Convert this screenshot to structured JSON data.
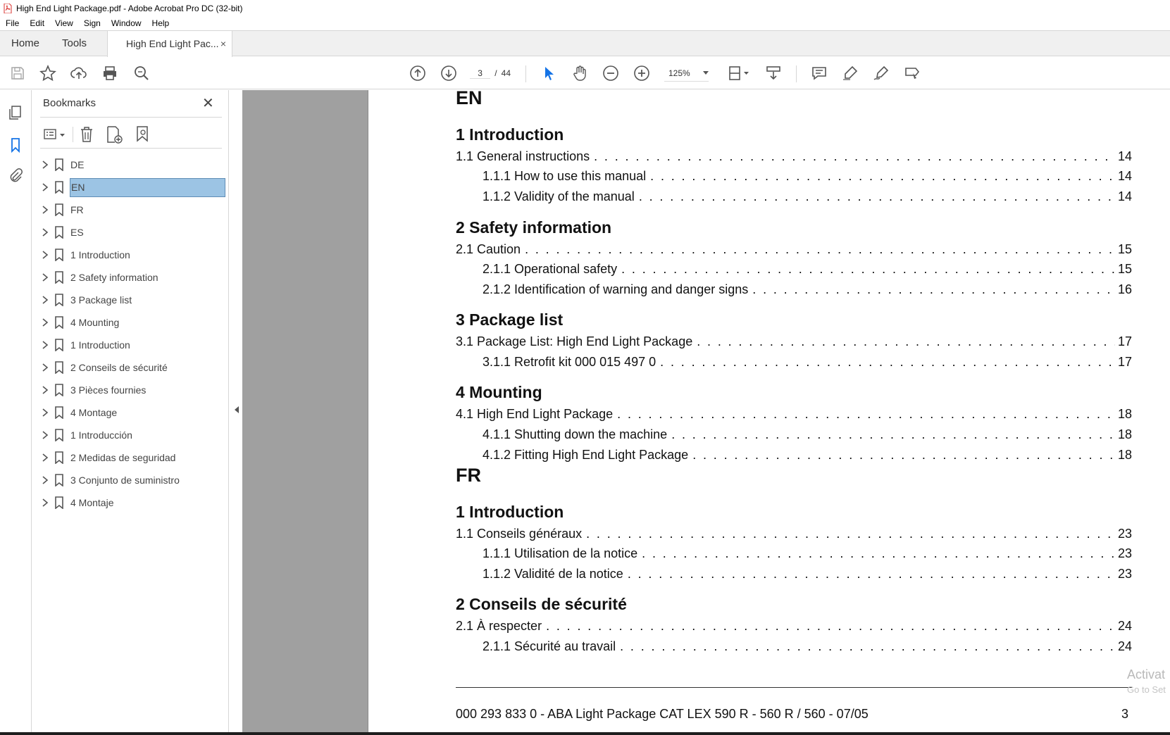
{
  "window": {
    "title": "High End Light Package.pdf - Adobe Acrobat Pro DC (32-bit)"
  },
  "menu": [
    "File",
    "Edit",
    "View",
    "Sign",
    "Window",
    "Help"
  ],
  "tabs": {
    "home": "Home",
    "tools": "Tools",
    "document": "High End Light Pac...",
    "close": "×"
  },
  "toolbar": {
    "page_current": "3",
    "page_sep": "/",
    "page_total": "44",
    "zoom": "125%"
  },
  "bookmarks": {
    "title": "Bookmarks",
    "close": "✕",
    "items": [
      "DE",
      "EN",
      "FR",
      "ES",
      "1 Introduction",
      "2 Safety information",
      "3 Package list",
      "4 Mounting",
      "1 Introduction",
      "2 Conseils de sécurité",
      "3 Pièces fournies",
      "4 Montage",
      "1 Introducción",
      "2 Medidas de seguridad",
      "3 Conjunto de suministro",
      "4 Montaje"
    ],
    "selected": "EN"
  },
  "document": {
    "en": {
      "lang": "EN",
      "ch1": "1 Introduction",
      "e1": {
        "t": "1.1 General instructions",
        "p": "14"
      },
      "e2": {
        "t": "1.1.1 How to use this manual",
        "p": "14"
      },
      "e3": {
        "t": "1.1.2 Validity of the manual",
        "p": "14"
      },
      "ch2": "2 Safety information",
      "e4": {
        "t": "2.1 Caution",
        "p": "15"
      },
      "e5": {
        "t": "2.1.1 Operational safety",
        "p": "15"
      },
      "e6": {
        "t": "2.1.2 Identification of warning and danger signs",
        "p": "16"
      },
      "ch3": "3 Package list",
      "e7": {
        "t": "3.1 Package List: High End Light Package",
        "p": "17"
      },
      "e8": {
        "t": "3.1.1 Retrofit kit 000 015 497 0",
        "p": "17"
      },
      "ch4": "4 Mounting",
      "e9": {
        "t": "4.1 High End Light Package",
        "p": "18"
      },
      "e10": {
        "t": "4.1.1 Shutting down the machine",
        "p": "18"
      },
      "e11": {
        "t": "4.1.2 Fitting High End Light Package",
        "p": "18"
      }
    },
    "fr": {
      "lang": "FR",
      "ch1": "1 Introduction",
      "e1": {
        "t": "1.1 Conseils généraux",
        "p": "23"
      },
      "e2": {
        "t": "1.1.1 Utilisation de la notice",
        "p": "23"
      },
      "e3": {
        "t": "1.1.2 Validité de la notice",
        "p": "23"
      },
      "ch2": "2 Conseils de sécurité",
      "e4": {
        "t": "2.1 À respecter",
        "p": "24"
      },
      "e5": {
        "t": "2.1.1 Sécurité au travail",
        "p": "24"
      }
    },
    "dots": ". . . . . . . . . . . . . . . . . . . . . . . . . . . . . . . . . . . . . . . . . . . . . . . . . . . . . . . . . . . . . . . . . . . . . . . . . . . . . . . . . . . . . . . . . . . . . . . . . . . . . . . . . . . . .",
    "footer": "000 293 833 0 - ABA Light Package CAT LEX 590 R - 560 R / 560 - 07/05",
    "footer_page": "3"
  },
  "watermark": {
    "line1": "Activat",
    "line2": "Go to Set"
  },
  "colors": {
    "selection": "#9cc4e4",
    "accent_blue": "#1473e6",
    "pdf_red": "#d9302c"
  }
}
